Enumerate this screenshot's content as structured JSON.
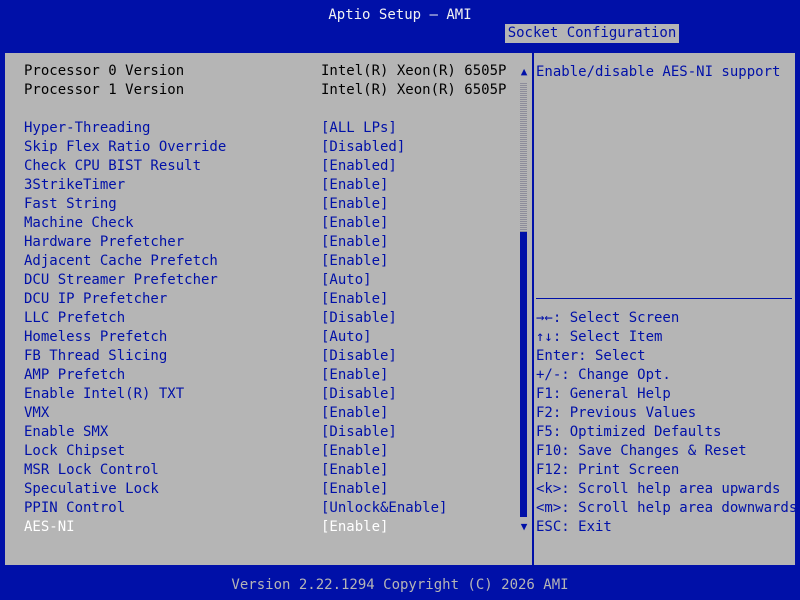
{
  "header": {
    "title": "Aptio Setup – AMI",
    "tab": "Socket Configuration"
  },
  "info_rows": [
    {
      "label": "Processor 0 Version",
      "value": "Intel(R) Xeon(R) 6505P"
    },
    {
      "label": "Processor 1 Version",
      "value": "Intel(R) Xeon(R) 6505P"
    }
  ],
  "options": [
    {
      "label": "Hyper-Threading",
      "value": "[ALL LPs]"
    },
    {
      "label": "Skip Flex Ratio Override",
      "value": "[Disabled]"
    },
    {
      "label": "Check CPU BIST Result",
      "value": "[Enabled]"
    },
    {
      "label": "3StrikeTimer",
      "value": "[Enable]"
    },
    {
      "label": "Fast String",
      "value": "[Enable]"
    },
    {
      "label": "Machine Check",
      "value": "[Enable]"
    },
    {
      "label": "Hardware Prefetcher",
      "value": "[Enable]"
    },
    {
      "label": "Adjacent Cache Prefetch",
      "value": "[Enable]"
    },
    {
      "label": "DCU Streamer Prefetcher",
      "value": "[Auto]"
    },
    {
      "label": "DCU IP Prefetcher",
      "value": "[Enable]"
    },
    {
      "label": "LLC Prefetch",
      "value": "[Disable]"
    },
    {
      "label": "Homeless Prefetch",
      "value": "[Auto]"
    },
    {
      "label": "FB Thread Slicing",
      "value": "[Disable]"
    },
    {
      "label": "AMP Prefetch",
      "value": "[Enable]"
    },
    {
      "label": "Enable Intel(R) TXT",
      "value": "[Disable]"
    },
    {
      "label": "VMX",
      "value": "[Enable]"
    },
    {
      "label": "Enable SMX",
      "value": "[Disable]"
    },
    {
      "label": "Lock Chipset",
      "value": "[Enable]"
    },
    {
      "label": "MSR Lock Control",
      "value": "[Enable]"
    },
    {
      "label": "Speculative Lock",
      "value": "[Enable]"
    },
    {
      "label": "PPIN Control",
      "value": "[Unlock&Enable]"
    },
    {
      "label": "AES-NI",
      "value": "[Enable]"
    }
  ],
  "help": {
    "text": "Enable/disable AES-NI support"
  },
  "keys": [
    "→←: Select Screen",
    "↑↓: Select Item",
    "Enter: Select",
    "+/-: Change Opt.",
    "F1: General Help",
    "F2: Previous Values",
    "F5: Optimized Defaults",
    "F10: Save Changes & Reset",
    "F12: Print Screen",
    "<k>: Scroll help area upwards",
    "<m>: Scroll help area downwards",
    "ESC: Exit"
  ],
  "scrollbar": {
    "up_icon": "▲",
    "down_icon": "▼"
  },
  "footer": {
    "version": "Version 2.22.1294 Copyright (C) 2026 AMI"
  },
  "colors": {
    "bios_blue": "#0010a8",
    "panel_gray": "#b5b5b5",
    "selected_text": "#ffffff"
  }
}
